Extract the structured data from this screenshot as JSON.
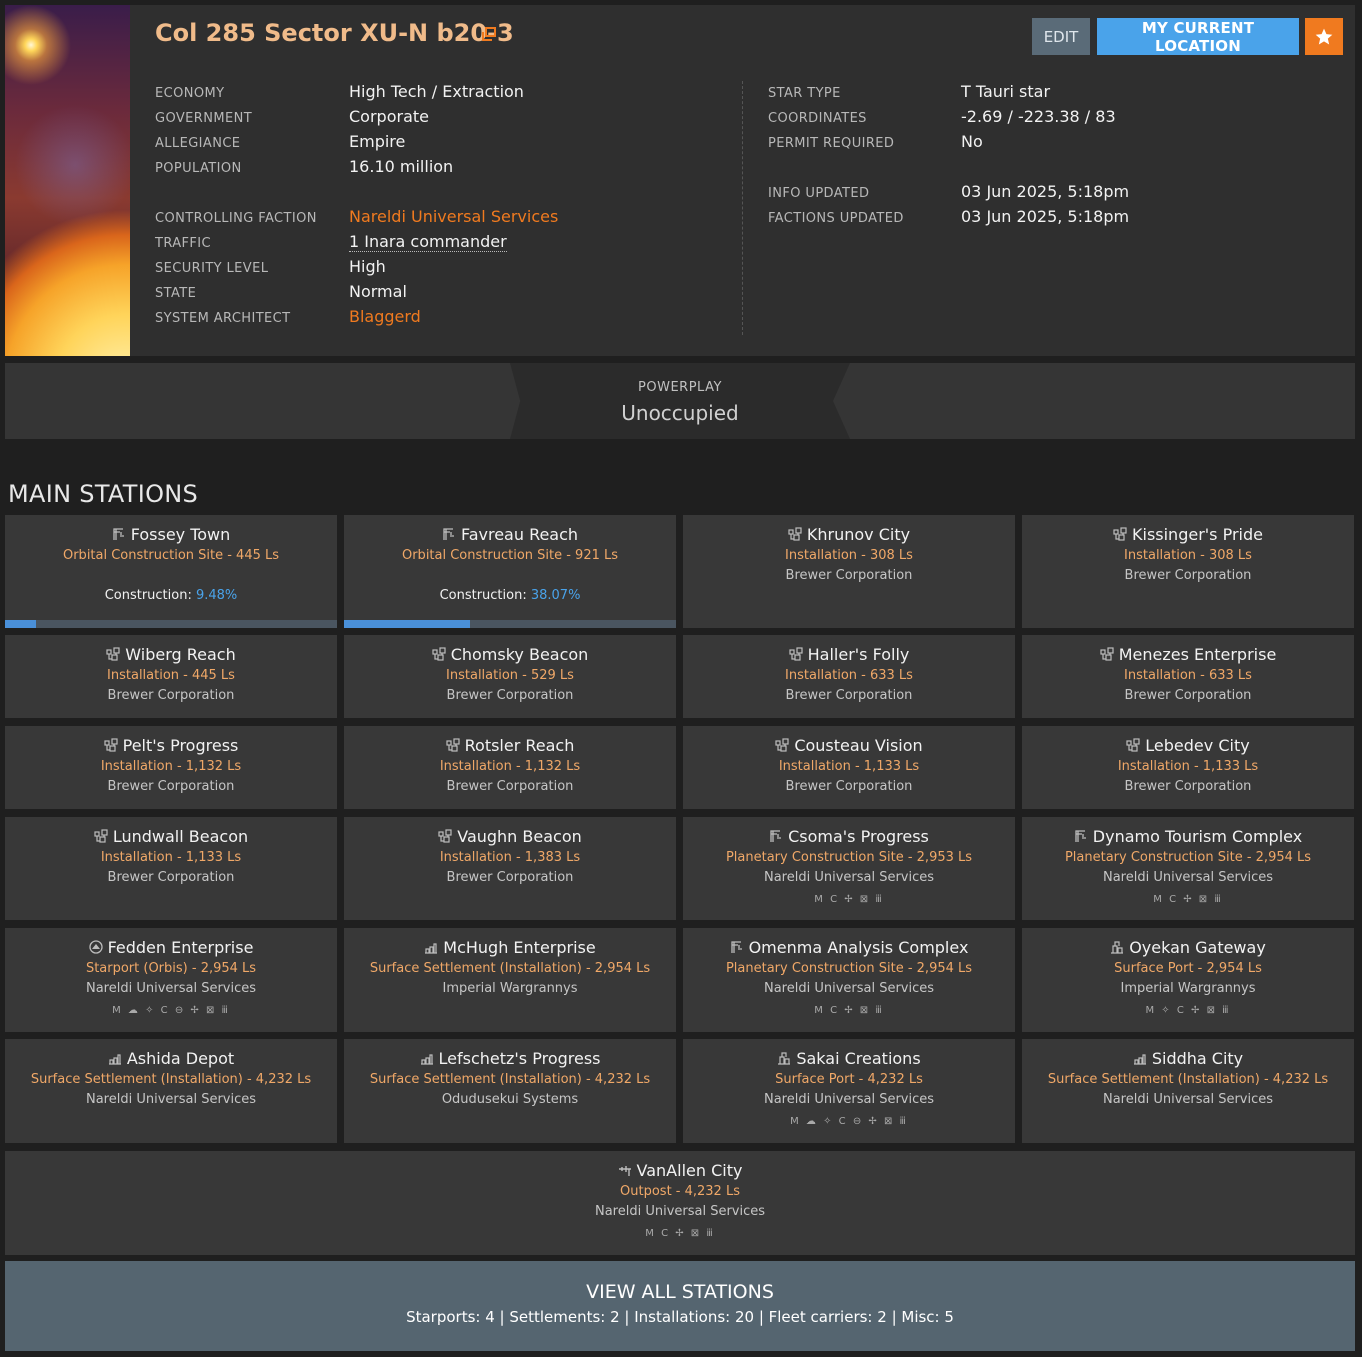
{
  "system": {
    "name": "Col 285 Sector XU-N b20-3",
    "edit_label": "EDIT",
    "location_label": "MY CURRENT LOCATION",
    "left_info": [
      {
        "label": "ECONOMY",
        "value": "High Tech / Extraction",
        "style": ""
      },
      {
        "label": "GOVERNMENT",
        "value": "Corporate",
        "style": ""
      },
      {
        "label": "ALLEGIANCE",
        "value": "Empire",
        "style": ""
      },
      {
        "label": "POPULATION",
        "value": "16.10 million",
        "style": ""
      },
      {
        "label": "CONTROLLING FACTION",
        "value": "Nareldi Universal Services",
        "style": "link"
      },
      {
        "label": "TRAFFIC",
        "value": "1 Inara commander",
        "style": "dotted"
      },
      {
        "label": "SECURITY LEVEL",
        "value": "High",
        "style": ""
      },
      {
        "label": "STATE",
        "value": "Normal",
        "style": ""
      },
      {
        "label": "SYSTEM ARCHITECT",
        "value": "Blaggerd",
        "style": "link"
      }
    ],
    "right_info": [
      {
        "label": "STAR TYPE",
        "value": "T Tauri star"
      },
      {
        "label": "COORDINATES",
        "value": "-2.69 / -223.38 / 83"
      },
      {
        "label": "PERMIT REQUIRED",
        "value": "No"
      },
      {
        "label": "INFO UPDATED",
        "value": "03 Jun 2025, 5:18pm"
      },
      {
        "label": "FACTIONS UPDATED",
        "value": "03 Jun 2025, 5:18pm"
      }
    ]
  },
  "powerplay": {
    "label": "POWERPLAY",
    "value": "Unoccupied"
  },
  "stations_title": "MAIN STATIONS",
  "stations": [
    {
      "name": "Fossey Town",
      "icon": "construction-site-icon",
      "type": "Orbital Construction Site - 445 Ls",
      "construction_label": "Construction:",
      "progress": "9.48%",
      "progress_fraction": 0.0948
    },
    {
      "name": "Favreau Reach",
      "icon": "construction-site-icon",
      "type": "Orbital Construction Site - 921 Ls",
      "construction_label": "Construction:",
      "progress": "38.07%",
      "progress_fraction": 0.3807
    },
    {
      "name": "Khrunov City",
      "icon": "installation-icon",
      "type": "Installation - 308 Ls",
      "owner": "Brewer Corporation"
    },
    {
      "name": "Kissinger's Pride",
      "icon": "installation-icon",
      "type": "Installation - 308 Ls",
      "owner": "Brewer Corporation"
    },
    {
      "name": "Wiberg Reach",
      "icon": "installation-icon",
      "type": "Installation - 445 Ls",
      "owner": "Brewer Corporation"
    },
    {
      "name": "Chomsky Beacon",
      "icon": "installation-icon",
      "type": "Installation - 529 Ls",
      "owner": "Brewer Corporation"
    },
    {
      "name": "Haller's Folly",
      "icon": "installation-icon",
      "type": "Installation - 633 Ls",
      "owner": "Brewer Corporation"
    },
    {
      "name": "Menezes Enterprise",
      "icon": "installation-icon",
      "type": "Installation - 633 Ls",
      "owner": "Brewer Corporation"
    },
    {
      "name": "Pelt's Progress",
      "icon": "installation-icon",
      "type": "Installation - 1,132 Ls",
      "owner": "Brewer Corporation"
    },
    {
      "name": "Rotsler Reach",
      "icon": "installation-icon",
      "type": "Installation - 1,132 Ls",
      "owner": "Brewer Corporation"
    },
    {
      "name": "Cousteau Vision",
      "icon": "installation-icon",
      "type": "Installation - 1,133 Ls",
      "owner": "Brewer Corporation"
    },
    {
      "name": "Lebedev City",
      "icon": "installation-icon",
      "type": "Installation - 1,133 Ls",
      "owner": "Brewer Corporation"
    },
    {
      "name": "Lundwall Beacon",
      "icon": "installation-icon",
      "type": "Installation - 1,133 Ls",
      "owner": "Brewer Corporation"
    },
    {
      "name": "Vaughn Beacon",
      "icon": "installation-icon",
      "type": "Installation - 1,383 Ls",
      "owner": "Brewer Corporation"
    },
    {
      "name": "Csoma's Progress",
      "icon": "construction-site-icon",
      "type": "Planetary Construction Site - 2,953 Ls",
      "owner": "Nareldi Universal Services",
      "services": "M C ✢ ⊠ ⅲ"
    },
    {
      "name": "Dynamo Tourism Complex",
      "icon": "construction-site-icon",
      "type": "Planetary Construction Site - 2,954 Ls",
      "owner": "Nareldi Universal Services",
      "services": "M C ✢ ⊠ ⅲ"
    },
    {
      "name": "Fedden Enterprise",
      "icon": "starport-icon",
      "type": "Starport (Orbis) - 2,954 Ls",
      "owner": "Nareldi Universal Services",
      "services": "M ☁ ✧ C ⊖ ✢ ⊠ ⅲ"
    },
    {
      "name": "McHugh Enterprise",
      "icon": "settlement-icon",
      "type": "Surface Settlement (Installation) - 2,954 Ls",
      "owner": "Imperial Wargrannys"
    },
    {
      "name": "Omenma Analysis Complex",
      "icon": "construction-site-icon",
      "type": "Planetary Construction Site - 2,954 Ls",
      "owner": "Nareldi Universal Services",
      "services": "M C ✢ ⊠ ⅲ"
    },
    {
      "name": "Oyekan Gateway",
      "icon": "surface-port-icon",
      "type": "Surface Port - 2,954 Ls",
      "owner": "Imperial Wargrannys",
      "services": "M ✧ C ✢ ⊠ ⅲ"
    },
    {
      "name": "Ashida Depot",
      "icon": "settlement-icon",
      "type": "Surface Settlement (Installation) - 4,232 Ls",
      "owner": "Nareldi Universal Services"
    },
    {
      "name": "Lefschetz's Progress",
      "icon": "settlement-icon",
      "type": "Surface Settlement (Installation) - 4,232 Ls",
      "owner": "Odudusekui Systems"
    },
    {
      "name": "Sakai Creations",
      "icon": "surface-port-icon",
      "type": "Surface Port - 4,232 Ls",
      "owner": "Nareldi Universal Services",
      "services": "M ☁ ✧ C ⊖ ✢ ⊠ ⅲ"
    },
    {
      "name": "Siddha City",
      "icon": "settlement-icon",
      "type": "Surface Settlement (Installation) - 4,232 Ls",
      "owner": "Nareldi Universal Services"
    },
    {
      "name": "VanAllen City",
      "icon": "outpost-icon",
      "type": "Outpost - 4,232 Ls",
      "owner": "Nareldi Universal Services",
      "services": "M C ✢ ⊠ ⅲ"
    }
  ],
  "view_all": {
    "title": "VIEW ALL STATIONS",
    "summary": "Starports: 4 | Settlements: 2 | Installations: 20 | Fleet carriers: 2 | Misc: 5"
  },
  "colors": {
    "accent": "#f07a1f",
    "link": "#f07a1f",
    "type_text": "#f0a868",
    "progress": "#4a90d9",
    "location_button": "#4aa3ea"
  }
}
